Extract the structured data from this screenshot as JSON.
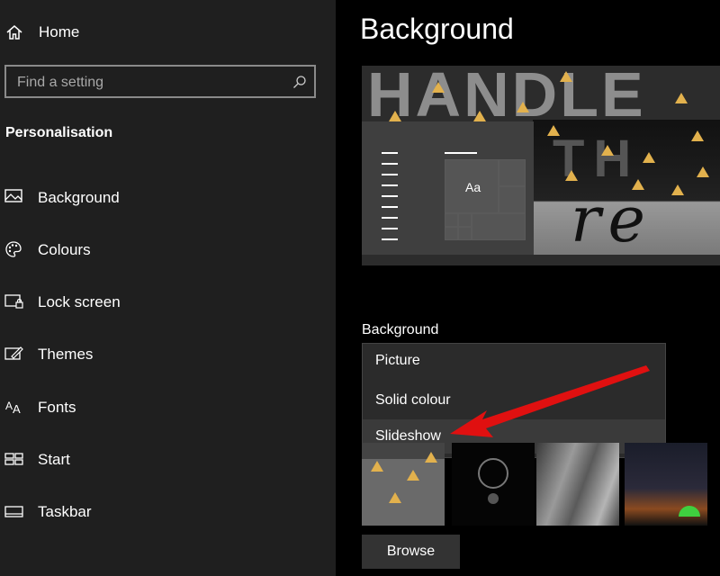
{
  "sidebar": {
    "home_label": "Home",
    "search_placeholder": "Find a setting",
    "section_title": "Personalisation",
    "items": [
      {
        "label": "Background",
        "icon": "image-icon"
      },
      {
        "label": "Colours",
        "icon": "palette-icon"
      },
      {
        "label": "Lock screen",
        "icon": "lock-screen-icon"
      },
      {
        "label": "Themes",
        "icon": "themes-icon"
      },
      {
        "label": "Fonts",
        "icon": "fonts-icon"
      },
      {
        "label": "Start",
        "icon": "start-icon"
      },
      {
        "label": "Taskbar",
        "icon": "taskbar-icon"
      }
    ]
  },
  "main": {
    "title": "Background",
    "preview": {
      "sample_text": "Aa",
      "wallpaper_line1": "HANDLE",
      "wallpaper_line2": "TH",
      "wallpaper_line3": "re"
    },
    "background_label": "Background",
    "dropdown_options": [
      "Picture",
      "Solid colour",
      "Slideshow"
    ],
    "browse_label": "Browse"
  },
  "colors": {
    "sidebar_bg": "#1f1f1f",
    "main_bg": "#000000",
    "dropdown_bg": "#2b2b2b",
    "dropdown_hover": "#3a3a3a",
    "annotation_arrow": "#e01010",
    "accent_gold": "#e2b14d"
  }
}
